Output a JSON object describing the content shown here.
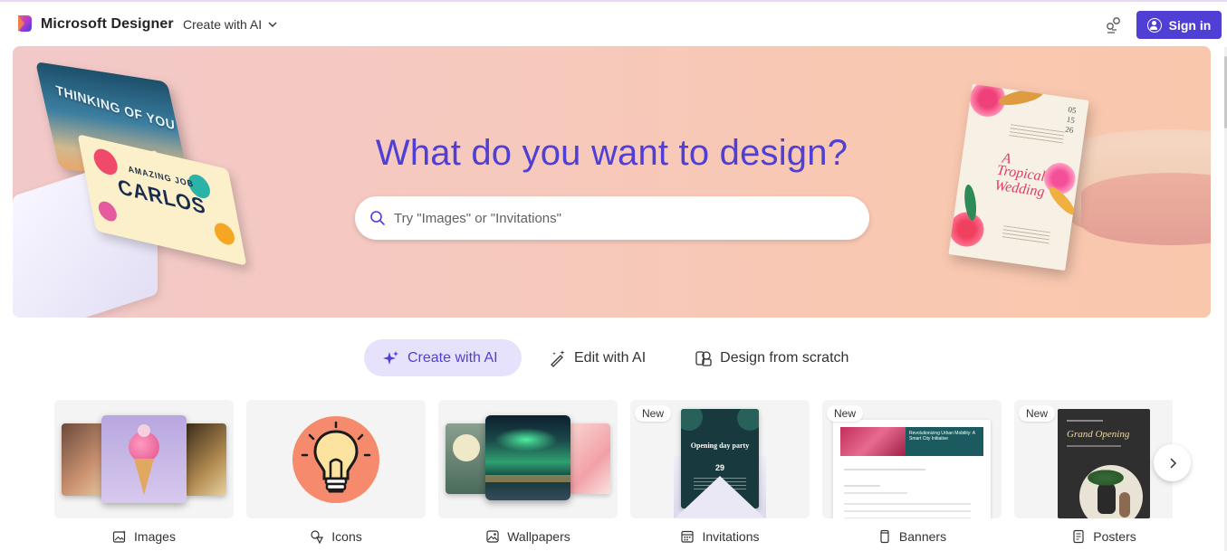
{
  "app": {
    "name": "Microsoft Designer",
    "menu_label": "Create with AI",
    "signin_label": "Sign in",
    "brand_color": "#4f3fd4"
  },
  "hero": {
    "title": "What do you want to design?",
    "search_placeholder": "Try \"Images\" or \"Invitations\"",
    "decor": {
      "thinking_card": "THINKING OF YOU",
      "carlos_card_small": "AMAZING JOB",
      "carlos_card_name": "CARLOS",
      "invite_date": "05 15 26",
      "invite_line1": "A",
      "invite_line2": "Tropical Wedding"
    }
  },
  "tabs": [
    {
      "label": "Create with AI",
      "icon": "sparkle-icon",
      "active": true
    },
    {
      "label": "Edit with AI",
      "icon": "magic-wand-icon",
      "active": false
    },
    {
      "label": "Design from scratch",
      "icon": "shapes-icon",
      "active": false
    }
  ],
  "categories": [
    {
      "label": "Images",
      "icon": "image-sparkle-icon",
      "badge": ""
    },
    {
      "label": "Icons",
      "icon": "shapes-icon",
      "badge": ""
    },
    {
      "label": "Wallpapers",
      "icon": "wallpaper-icon",
      "badge": ""
    },
    {
      "label": "Invitations",
      "icon": "calendar-icon",
      "badge": "New"
    },
    {
      "label": "Banners",
      "icon": "banner-icon",
      "badge": "New"
    },
    {
      "label": "Posters",
      "icon": "poster-icon",
      "badge": "New"
    }
  ],
  "invitation_preview": {
    "title": "Opening day party",
    "day": "29"
  },
  "banner_preview": {
    "title": "Revolutionizing Urban Mobility: A Smart City Initiative"
  },
  "poster_preview": {
    "title": "Grand Opening"
  }
}
